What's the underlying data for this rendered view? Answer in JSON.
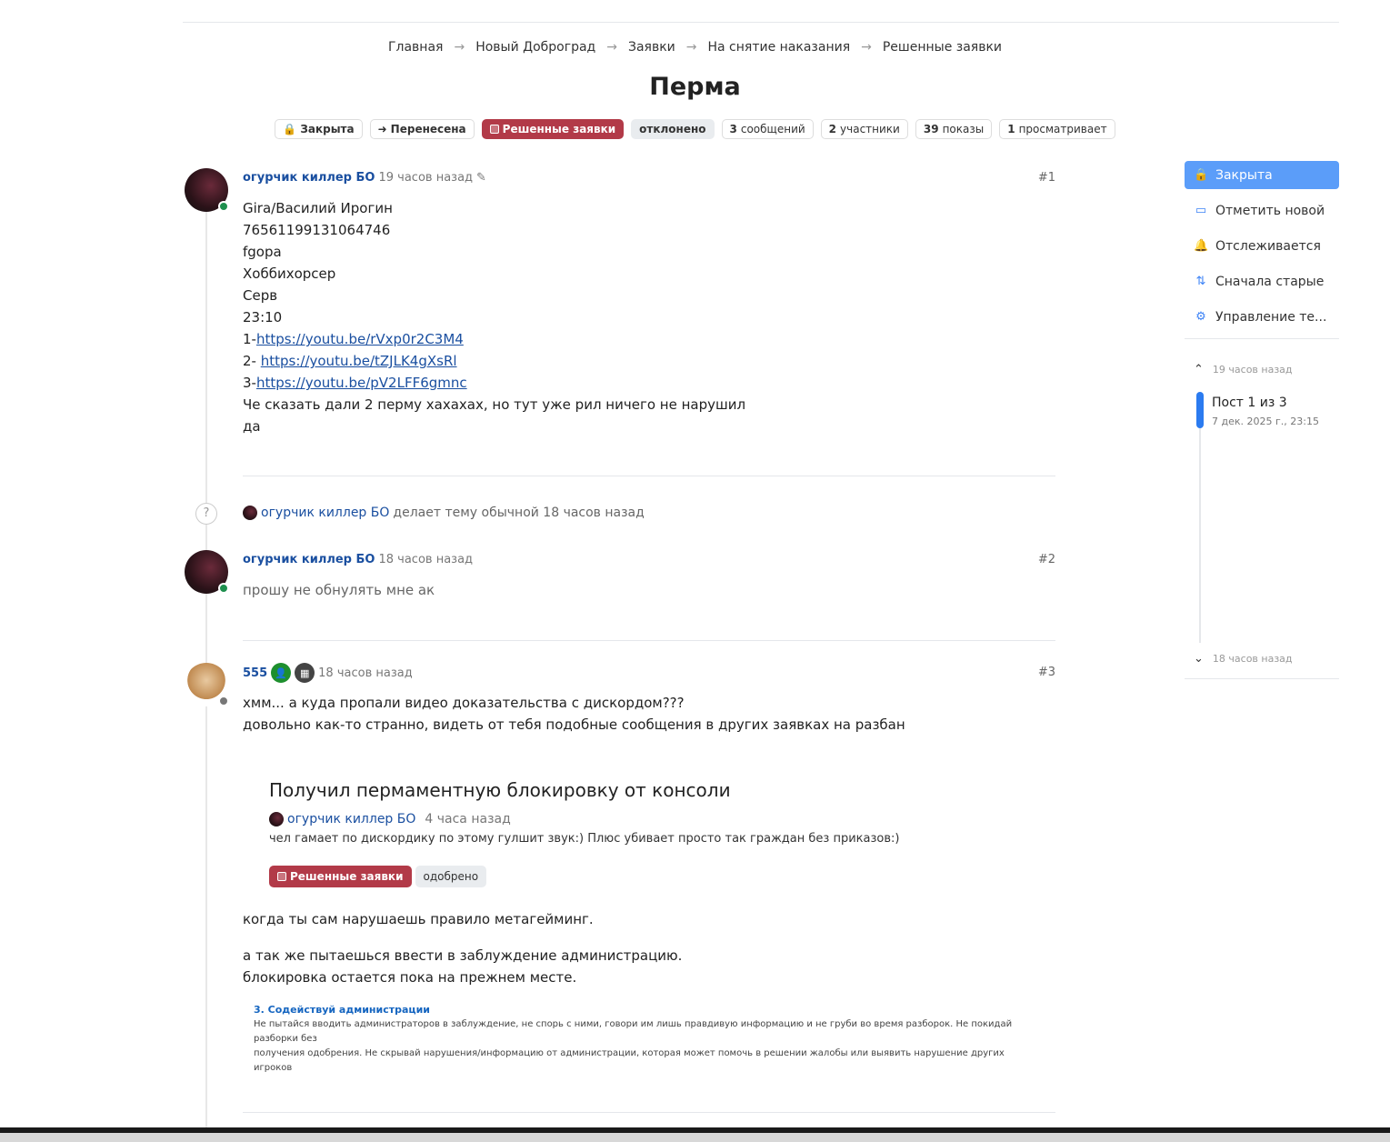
{
  "breadcrumb": {
    "items": [
      "Главная",
      "Новый Доброград",
      "Заявки",
      "На снятие наказания",
      "Решенные заявки"
    ],
    "separator": "→"
  },
  "thread": {
    "title": "Перма",
    "badges": {
      "closed": "Закрыта",
      "moved": "Перенесена",
      "resolved": "Решенные заявки",
      "rejected": "отклонено",
      "messages_count": "3",
      "messages_label": "сообщений",
      "participants_count": "2",
      "participants_label": "участники",
      "views_count": "39",
      "views_label": "показы",
      "watching_count": "1",
      "watching_label": "просматривает"
    }
  },
  "posts": [
    {
      "author": "огурчик киллер БО",
      "time": "19 часов назад",
      "number": "#1",
      "lines": [
        "Gira/Василий Ирогин",
        "76561199131064746",
        "fgopa",
        "Хоббихорсер",
        "Серв",
        "23:10"
      ],
      "link1_prefix": "1-",
      "link1": "https://youtu.be/rVxp0r2C3M4",
      "link2_prefix": "2- ",
      "link2": "https://youtu.be/tZJLK4gXsRl",
      "link3_prefix": "3-",
      "link3": "https://youtu.be/pV2LFF6gmnc",
      "line_after1": "Че сказать дали 2 перму хахахах, но тут уже рил ничего не нарушил",
      "line_after2": "да"
    },
    {
      "author": "огурчик киллер БО",
      "time": "18 часов назад",
      "number": "#2",
      "text": "прошу не обнулять мне ак"
    },
    {
      "author": "555",
      "time": "18 часов назад",
      "number": "#3",
      "line1": "хмм... а куда пропали видео доказательства с дискордом???",
      "line2": "довольно как-то странно, видеть от тебя подобные сообщения в других заявках на разбан",
      "after1": "когда ты сам нарушаешь правило метагейминг.",
      "after2": "а так же пытаешься ввести в заблуждение администрацию.",
      "after3": "блокировка остается пока на прежнем месте."
    }
  ],
  "event": {
    "author": "огурчик киллер БО",
    "text": "делает тему обычной 18 часов назад",
    "icon": "?"
  },
  "quote": {
    "title": "Получил пермаментную блокировку от консоли",
    "author": "огурчик киллер БО",
    "time": "4 часа назад",
    "text": "чел гамает по дискордику по этому гулшит звук:) Плюс убивает просто так граждан без приказов:)",
    "badge_resolved": "Решенные заявки",
    "badge_status": "одобрено"
  },
  "rules": {
    "heading": "3. Содействуй администрации",
    "line1": "Не пытайся вводить администраторов в заблуждение, не спорь с ними, говори им лишь правдивую информацию и не груби во время разборок. Не покидай разборки без",
    "line2": "получения одобрения. Не скрывай нарушения/информацию от администрации, которая может помочь в решении жалобы или выявить нарушение других игроков"
  },
  "sidebar": {
    "closed": "Закрыта",
    "mark_new": "Отметить новой",
    "watching": "Отслеживается",
    "oldest_first": "Сначала старые",
    "manage": "Управление те...",
    "scrub_top": "19 часов назад",
    "scrub_position": "Пост 1 из 3",
    "scrub_date": "7 дек. 2025 г., 23:15",
    "scrub_bottom": "18 часов назад"
  },
  "colors": {
    "accent": "#1a4fa0",
    "resolved": "#b23a48",
    "sidebar_active": "#5b9df9",
    "online": "#1e8f4e"
  }
}
